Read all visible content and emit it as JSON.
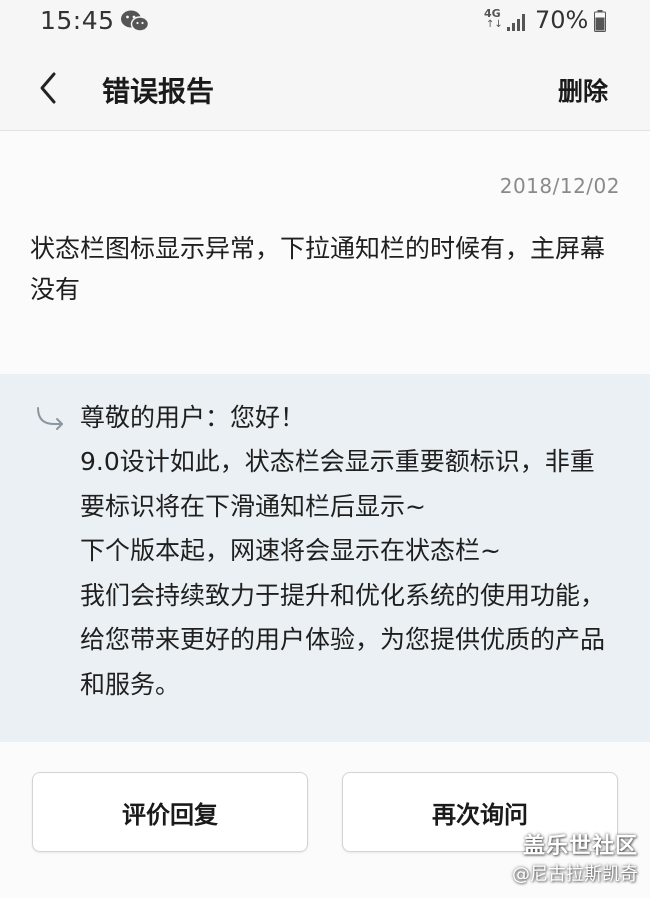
{
  "status_bar": {
    "time": "15:45",
    "network": "4G",
    "network_arrows": "↑↓",
    "battery": "70%",
    "icons": [
      "wechat-icon",
      "signal-icon",
      "battery-icon"
    ]
  },
  "header": {
    "title": "错误报告",
    "delete_label": "删除",
    "back_icon": "chevron-left-icon"
  },
  "report": {
    "date": "2018/12/02",
    "text": "状态栏图标显示异常，下拉通知栏的时候有，主屏幕没有"
  },
  "reply": {
    "icon": "reply-arrow-icon",
    "greeting": "尊敬的用户：您好！",
    "body": "9.0设计如此，状态栏会显示重要额标识，非重要标识将在下滑通知栏后显示~\n下个版本起，网速将会显示在状态栏~\n我们会持续致力于提升和优化系统的使用功能，给您带来更好的用户体验，为您提供优质的产品和服务。"
  },
  "actions": {
    "rate_label": "评价回复",
    "ask_again_label": "再次询问"
  },
  "watermark": {
    "community": "盖乐世社区",
    "author": "@尼古拉斯凯奇"
  },
  "colors": {
    "reply_background": "#eaf0f3",
    "page_background": "#fbfbfb",
    "date_text": "#8a8a8a"
  }
}
